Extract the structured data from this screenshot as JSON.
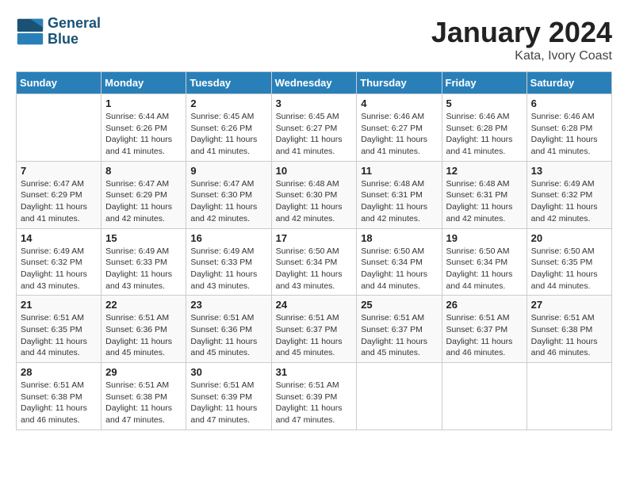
{
  "header": {
    "logo_line1": "General",
    "logo_line2": "Blue",
    "month_title": "January 2024",
    "location": "Kata, Ivory Coast"
  },
  "weekdays": [
    "Sunday",
    "Monday",
    "Tuesday",
    "Wednesday",
    "Thursday",
    "Friday",
    "Saturday"
  ],
  "weeks": [
    [
      {
        "day": "",
        "info": ""
      },
      {
        "day": "1",
        "info": "Sunrise: 6:44 AM\nSunset: 6:26 PM\nDaylight: 11 hours\nand 41 minutes."
      },
      {
        "day": "2",
        "info": "Sunrise: 6:45 AM\nSunset: 6:26 PM\nDaylight: 11 hours\nand 41 minutes."
      },
      {
        "day": "3",
        "info": "Sunrise: 6:45 AM\nSunset: 6:27 PM\nDaylight: 11 hours\nand 41 minutes."
      },
      {
        "day": "4",
        "info": "Sunrise: 6:46 AM\nSunset: 6:27 PM\nDaylight: 11 hours\nand 41 minutes."
      },
      {
        "day": "5",
        "info": "Sunrise: 6:46 AM\nSunset: 6:28 PM\nDaylight: 11 hours\nand 41 minutes."
      },
      {
        "day": "6",
        "info": "Sunrise: 6:46 AM\nSunset: 6:28 PM\nDaylight: 11 hours\nand 41 minutes."
      }
    ],
    [
      {
        "day": "7",
        "info": "Sunrise: 6:47 AM\nSunset: 6:29 PM\nDaylight: 11 hours\nand 41 minutes."
      },
      {
        "day": "8",
        "info": "Sunrise: 6:47 AM\nSunset: 6:29 PM\nDaylight: 11 hours\nand 42 minutes."
      },
      {
        "day": "9",
        "info": "Sunrise: 6:47 AM\nSunset: 6:30 PM\nDaylight: 11 hours\nand 42 minutes."
      },
      {
        "day": "10",
        "info": "Sunrise: 6:48 AM\nSunset: 6:30 PM\nDaylight: 11 hours\nand 42 minutes."
      },
      {
        "day": "11",
        "info": "Sunrise: 6:48 AM\nSunset: 6:31 PM\nDaylight: 11 hours\nand 42 minutes."
      },
      {
        "day": "12",
        "info": "Sunrise: 6:48 AM\nSunset: 6:31 PM\nDaylight: 11 hours\nand 42 minutes."
      },
      {
        "day": "13",
        "info": "Sunrise: 6:49 AM\nSunset: 6:32 PM\nDaylight: 11 hours\nand 42 minutes."
      }
    ],
    [
      {
        "day": "14",
        "info": "Sunrise: 6:49 AM\nSunset: 6:32 PM\nDaylight: 11 hours\nand 43 minutes."
      },
      {
        "day": "15",
        "info": "Sunrise: 6:49 AM\nSunset: 6:33 PM\nDaylight: 11 hours\nand 43 minutes."
      },
      {
        "day": "16",
        "info": "Sunrise: 6:49 AM\nSunset: 6:33 PM\nDaylight: 11 hours\nand 43 minutes."
      },
      {
        "day": "17",
        "info": "Sunrise: 6:50 AM\nSunset: 6:34 PM\nDaylight: 11 hours\nand 43 minutes."
      },
      {
        "day": "18",
        "info": "Sunrise: 6:50 AM\nSunset: 6:34 PM\nDaylight: 11 hours\nand 44 minutes."
      },
      {
        "day": "19",
        "info": "Sunrise: 6:50 AM\nSunset: 6:34 PM\nDaylight: 11 hours\nand 44 minutes."
      },
      {
        "day": "20",
        "info": "Sunrise: 6:50 AM\nSunset: 6:35 PM\nDaylight: 11 hours\nand 44 minutes."
      }
    ],
    [
      {
        "day": "21",
        "info": "Sunrise: 6:51 AM\nSunset: 6:35 PM\nDaylight: 11 hours\nand 44 minutes."
      },
      {
        "day": "22",
        "info": "Sunrise: 6:51 AM\nSunset: 6:36 PM\nDaylight: 11 hours\nand 45 minutes."
      },
      {
        "day": "23",
        "info": "Sunrise: 6:51 AM\nSunset: 6:36 PM\nDaylight: 11 hours\nand 45 minutes."
      },
      {
        "day": "24",
        "info": "Sunrise: 6:51 AM\nSunset: 6:37 PM\nDaylight: 11 hours\nand 45 minutes."
      },
      {
        "day": "25",
        "info": "Sunrise: 6:51 AM\nSunset: 6:37 PM\nDaylight: 11 hours\nand 45 minutes."
      },
      {
        "day": "26",
        "info": "Sunrise: 6:51 AM\nSunset: 6:37 PM\nDaylight: 11 hours\nand 46 minutes."
      },
      {
        "day": "27",
        "info": "Sunrise: 6:51 AM\nSunset: 6:38 PM\nDaylight: 11 hours\nand 46 minutes."
      }
    ],
    [
      {
        "day": "28",
        "info": "Sunrise: 6:51 AM\nSunset: 6:38 PM\nDaylight: 11 hours\nand 46 minutes."
      },
      {
        "day": "29",
        "info": "Sunrise: 6:51 AM\nSunset: 6:38 PM\nDaylight: 11 hours\nand 47 minutes."
      },
      {
        "day": "30",
        "info": "Sunrise: 6:51 AM\nSunset: 6:39 PM\nDaylight: 11 hours\nand 47 minutes."
      },
      {
        "day": "31",
        "info": "Sunrise: 6:51 AM\nSunset: 6:39 PM\nDaylight: 11 hours\nand 47 minutes."
      },
      {
        "day": "",
        "info": ""
      },
      {
        "day": "",
        "info": ""
      },
      {
        "day": "",
        "info": ""
      }
    ]
  ]
}
